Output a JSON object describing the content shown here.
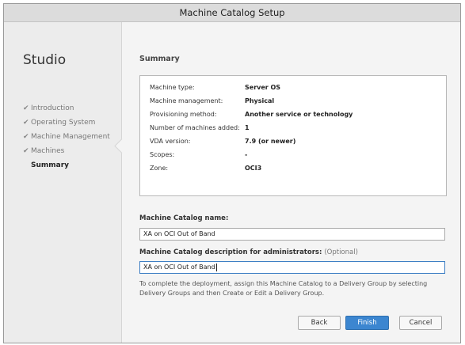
{
  "window": {
    "title": "Machine Catalog Setup"
  },
  "sidebar": {
    "title": "Studio",
    "steps": [
      {
        "label": "Introduction",
        "done": true
      },
      {
        "label": "Operating System",
        "done": true
      },
      {
        "label": "Machine Management",
        "done": true
      },
      {
        "label": "Machines",
        "done": true
      },
      {
        "label": "Summary",
        "done": false,
        "active": true
      }
    ],
    "check_glyph": "✔"
  },
  "main": {
    "heading": "Summary",
    "summary_rows": [
      {
        "key": "Machine type:",
        "value": "Server OS"
      },
      {
        "key": "Machine management:",
        "value": "Physical"
      },
      {
        "key": "Provisioning method:",
        "value": "Another service or technology"
      },
      {
        "key": "Number of machines added:",
        "value": "1"
      },
      {
        "key": "VDA version:",
        "value": "7.9 (or newer)"
      },
      {
        "key": "Scopes:",
        "value": "-"
      },
      {
        "key": "Zone:",
        "value": "OCI3"
      }
    ],
    "catalog_name_label": "Machine Catalog name:",
    "catalog_name_value": "XA on OCI Out of Band",
    "description_label": "Machine Catalog description for administrators:",
    "description_optional": "(Optional)",
    "description_value": "XA on OCI Out of Band",
    "info_text": "To complete the deployment, assign this Machine Catalog to a Delivery Group by selecting Delivery Groups and then Create or Edit a Delivery Group."
  },
  "buttons": {
    "back": "Back",
    "finish": "Finish",
    "cancel": "Cancel"
  },
  "colors": {
    "accent": "#3c86d0",
    "focus_border": "#3e7fc4"
  }
}
